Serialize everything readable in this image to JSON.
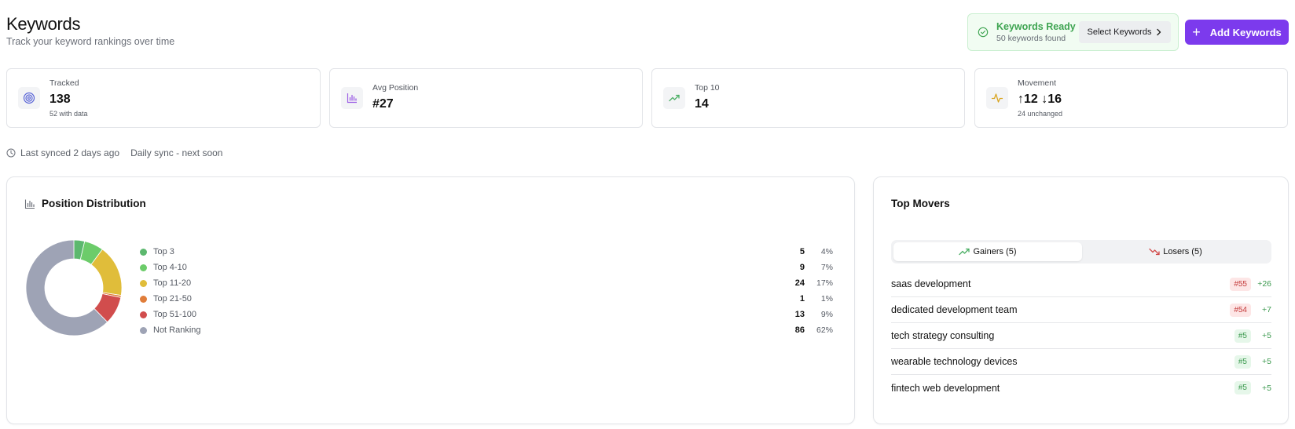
{
  "header": {
    "title": "Keywords",
    "subtitle": "Track your keyword rankings over time"
  },
  "ready": {
    "title": "Keywords Ready",
    "subtitle": "50 keywords found",
    "select_label": "Select Keywords"
  },
  "add_label": "Add Keywords",
  "stats": {
    "tracked": {
      "label": "Tracked",
      "value": "138",
      "sub": "52 with data"
    },
    "avg_position": {
      "label": "Avg Position",
      "value": "#27"
    },
    "top10": {
      "label": "Top 10",
      "value": "14"
    },
    "movement": {
      "label": "Movement",
      "value": "↑12 ↓16",
      "sub": "24 unchanged"
    }
  },
  "sync": {
    "last_synced": "Last synced 2 days ago",
    "schedule": "Daily sync - next soon"
  },
  "distribution": {
    "title": "Position Distribution",
    "items": [
      {
        "label": "Top 3",
        "count": "5",
        "pct": "4%",
        "value": 5,
        "color": "#5cb86e"
      },
      {
        "label": "Top 4-10",
        "count": "9",
        "pct": "7%",
        "value": 9,
        "color": "#6ccc6a"
      },
      {
        "label": "Top 11-20",
        "count": "24",
        "pct": "17%",
        "value": 24,
        "color": "#e0bd3a"
      },
      {
        "label": "Top 21-50",
        "count": "1",
        "pct": "1%",
        "value": 1,
        "color": "#e07d3a"
      },
      {
        "label": "Top 51-100",
        "count": "13",
        "pct": "9%",
        "value": 13,
        "color": "#d14d4d"
      },
      {
        "label": "Not Ranking",
        "count": "86",
        "pct": "62%",
        "value": 86,
        "color": "#9ea3b5"
      }
    ]
  },
  "movers": {
    "title": "Top Movers",
    "tab_gainers": "Gainers (5)",
    "tab_losers": "Losers (5)",
    "items": [
      {
        "name": "saas development",
        "position": "#55",
        "delta": "+26",
        "badge": "bad"
      },
      {
        "name": "dedicated development team",
        "position": "#54",
        "delta": "+7",
        "badge": "bad"
      },
      {
        "name": "tech strategy consulting",
        "position": "#5",
        "delta": "+5",
        "badge": "good"
      },
      {
        "name": "wearable technology devices",
        "position": "#5",
        "delta": "+5",
        "badge": "good"
      },
      {
        "name": "fintech web development",
        "position": "#5",
        "delta": "+5",
        "badge": "good"
      }
    ]
  },
  "colors": {
    "accent": "#7c3aed",
    "success": "#3ea451",
    "danger": "#c43a3a"
  },
  "icons": {
    "ready": "check-circle-icon",
    "select": "chevron-right-icon",
    "add": "plus-icon",
    "tracked": "target-icon",
    "avg_position": "bar-chart-icon",
    "top10": "trending-up-icon",
    "movement": "activity-icon",
    "sync": "clock-icon",
    "gainers": "trending-up-icon",
    "losers": "trending-down-icon"
  }
}
